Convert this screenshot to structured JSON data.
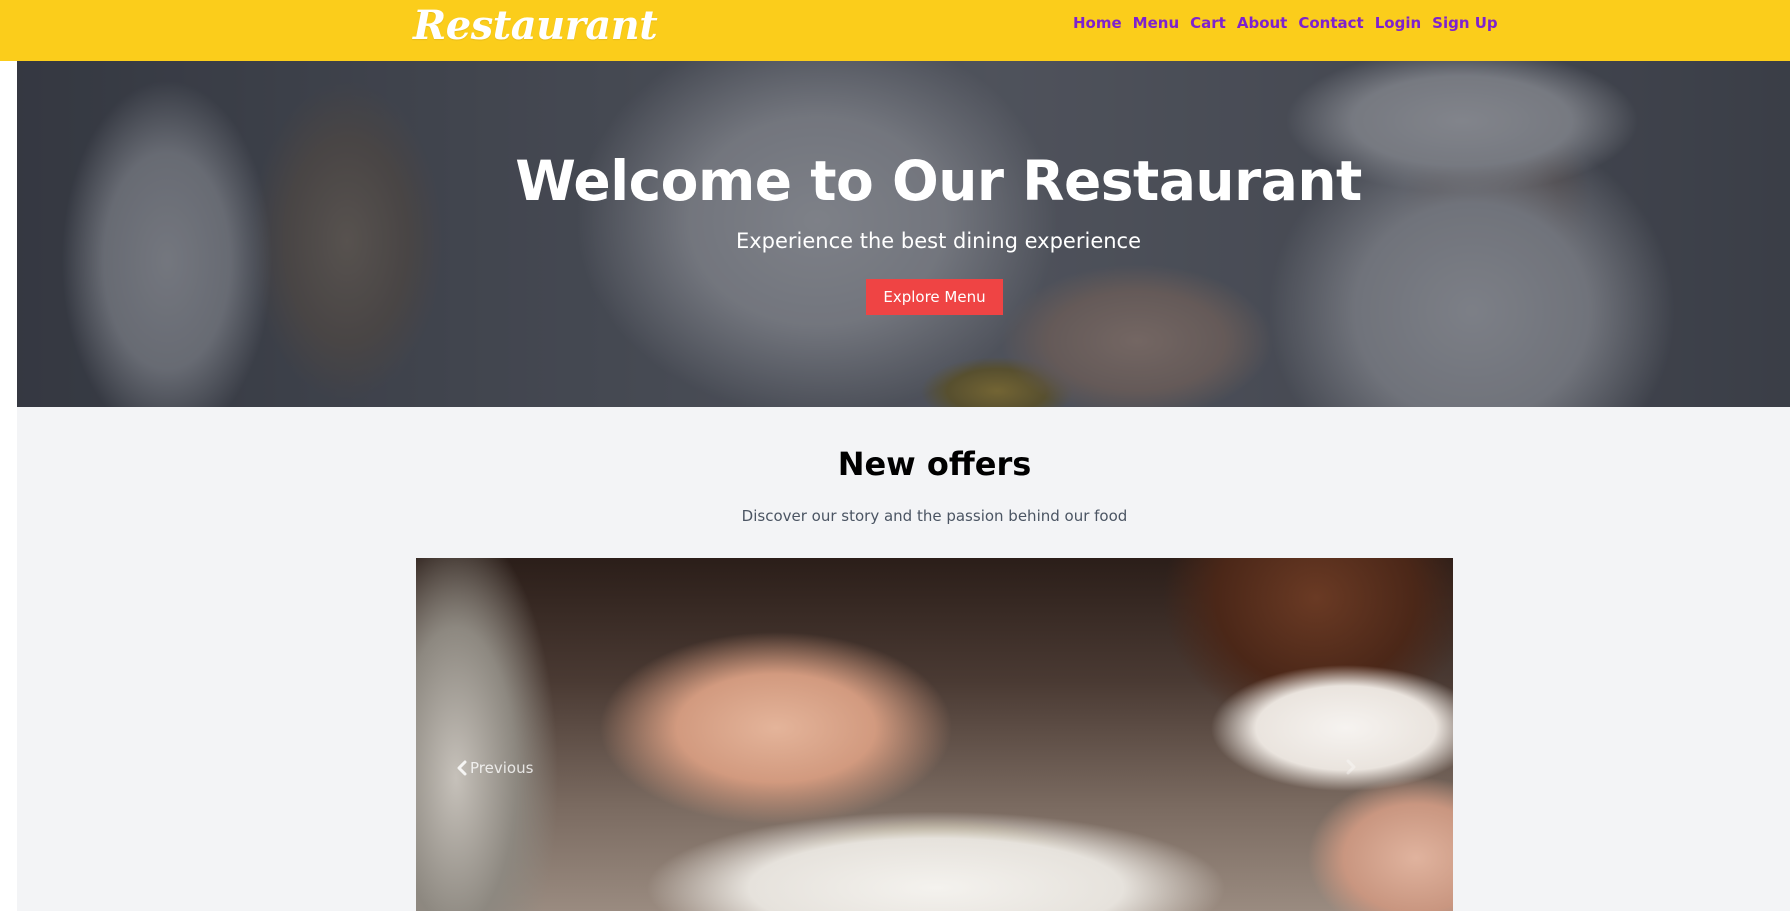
{
  "navbar": {
    "logo": "Restaurant",
    "links": [
      "Home",
      "Menu",
      "Cart",
      "About",
      "Contact",
      "Login",
      "Sign Up"
    ]
  },
  "hero": {
    "title": "Welcome to Our Restaurant",
    "subtitle": "Experience the best dining experience",
    "button_label": "Explore Menu"
  },
  "offers": {
    "title": "New offers",
    "subtitle": "Discover our story and the passion behind our food",
    "carousel": {
      "prev_label": "Previous"
    }
  },
  "colors": {
    "navbar_bg": "#fbcd1b",
    "nav_link": "#7e22ce",
    "hero_button": "#ef4444",
    "section_bg": "#f3f4f6"
  },
  "icons": {
    "carousel_prev": "chevron-left-icon",
    "carousel_next": "chevron-right-icon"
  }
}
